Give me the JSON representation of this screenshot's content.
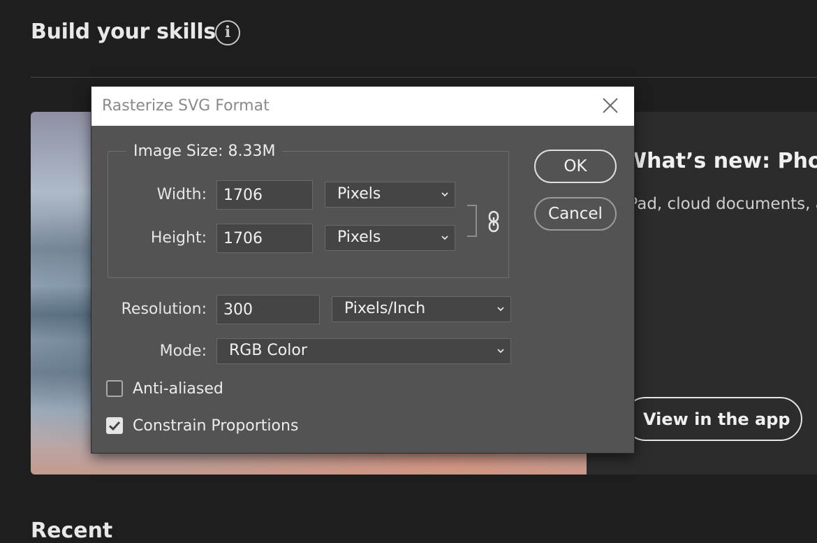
{
  "background": {
    "section_title": "Build your skills",
    "info_icon": "i",
    "hero_heading": "What’s new: Photo",
    "hero_subtitle": "iPad, cloud documents, a",
    "view_button": "View in the app",
    "recent_title": "Recent"
  },
  "dialog": {
    "title": "Rasterize SVG Format",
    "image_size_label": "Image Size: 8.33M",
    "width_label": "Width:",
    "width_value": "1706",
    "width_unit": "Pixels",
    "height_label": "Height:",
    "height_value": "1706",
    "height_unit": "Pixels",
    "resolution_label": "Resolution:",
    "resolution_value": "300",
    "resolution_unit": "Pixels/Inch",
    "mode_label": "Mode:",
    "mode_value": "RGB Color",
    "anti_aliased_label": "Anti-aliased",
    "anti_aliased_checked": false,
    "constrain_label": "Constrain Proportions",
    "constrain_checked": true,
    "ok_label": "OK",
    "cancel_label": "Cancel"
  }
}
